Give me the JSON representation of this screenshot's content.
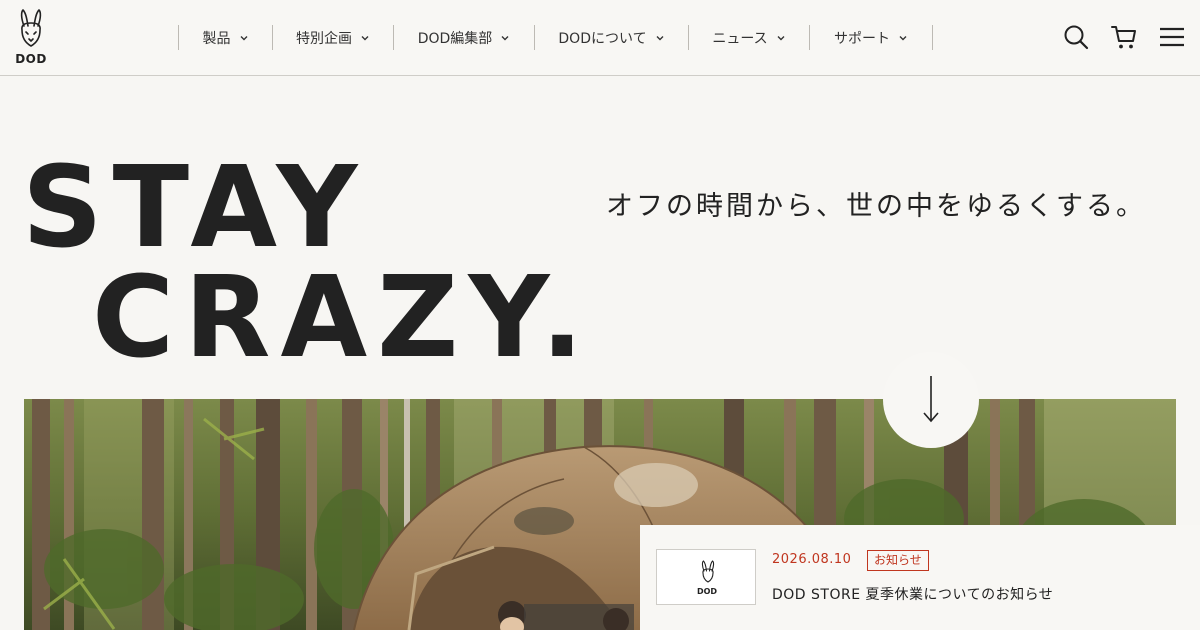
{
  "brand": {
    "logo_text": "DOD"
  },
  "nav": {
    "items": [
      {
        "label": "製品"
      },
      {
        "label": "特別企画"
      },
      {
        "label": "DOD編集部"
      },
      {
        "label": "DODについて"
      },
      {
        "label": "ニュース"
      },
      {
        "label": "サポート"
      }
    ]
  },
  "header_icons": [
    "search-icon",
    "cart-icon",
    "menu-icon"
  ],
  "hero": {
    "line1": "STAY",
    "line2": "CRAZY.",
    "tagline": "オフの時間から、世の中をゆるくする。"
  },
  "news": {
    "thumb_logo": "DOD",
    "date": "2026.08.10",
    "badge": "お知らせ",
    "title": "DOD STORE 夏季休業についてのお知らせ"
  },
  "colors": {
    "background": "#f7f6f3",
    "text": "#222222",
    "accent": "#c0361f"
  }
}
